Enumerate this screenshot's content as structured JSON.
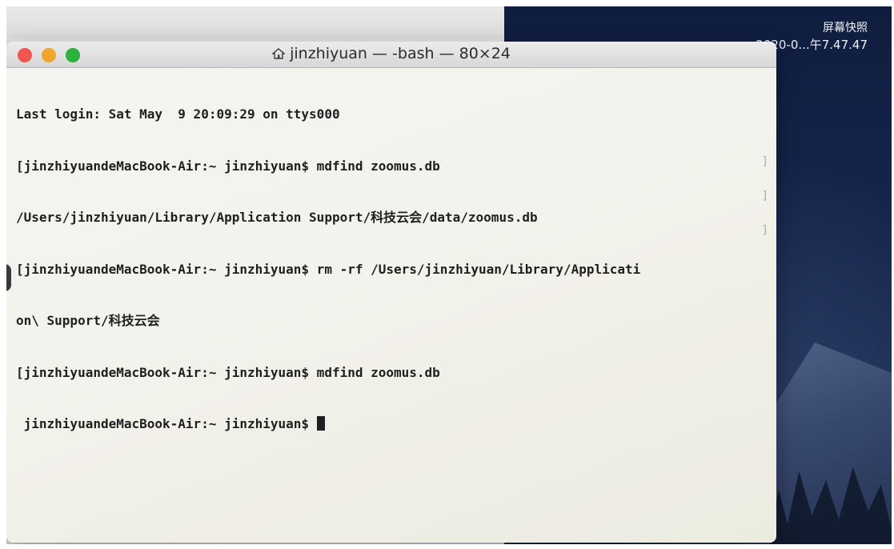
{
  "desktop": {
    "file_name": "屏幕快照",
    "file_date": "2020-0...午7.47.47"
  },
  "window": {
    "title": "jinzhiyuan — -bash — 80×24",
    "home_icon": "house-icon"
  },
  "terminal": {
    "lines": [
      "Last login: Sat May  9 20:09:29 on ttys000",
      "[jinzhiyuandeMacBook-Air:~ jinzhiyuan$ mdfind zoomus.db",
      "/Users/jinzhiyuan/Library/Application Support/科技云会/data/zoomus.db",
      "[jinzhiyuandeMacBook-Air:~ jinzhiyuan$ rm -rf /Users/jinzhiyuan/Library/Applicati",
      "on\\ Support/科技云会",
      "[jinzhiyuandeMacBook-Air:~ jinzhiyuan$ mdfind zoomus.db",
      " jinzhiyuandeMacBook-Air:~ jinzhiyuan$ "
    ],
    "scroll_marks": [
      "]",
      "]",
      "]"
    ]
  }
}
